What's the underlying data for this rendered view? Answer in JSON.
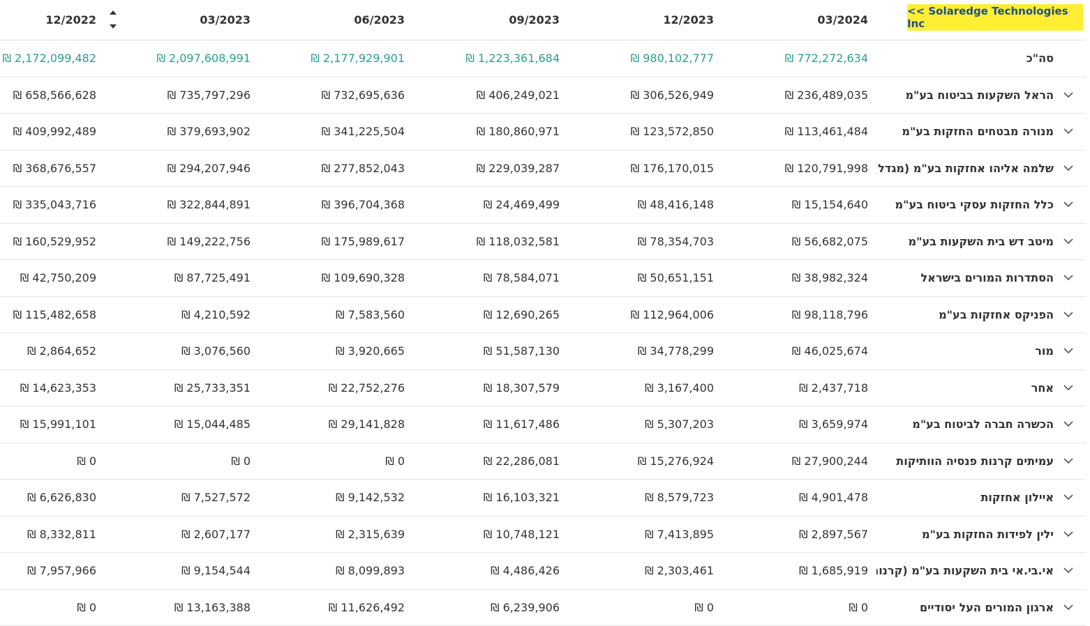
{
  "header": {
    "columns": [
      "12/2022",
      "03/2023",
      "06/2023",
      "09/2023",
      "12/2023",
      "03/2024"
    ],
    "company_link": "<< Solaredge Technologies Inc"
  },
  "total": {
    "label": "סה\"כ",
    "values": [
      "₪ 2,172,099,482",
      "₪ 2,097,608,991",
      "₪ 2,177,929,901",
      "₪ 1,223,361,684",
      "₪ 980,102,777",
      "₪ 772,272,634"
    ]
  },
  "rows": [
    {
      "name": "הראל השקעות בביטוח בע\"מ",
      "values": [
        "₪ 658,566,628",
        "₪ 735,797,296",
        "₪ 732,695,636",
        "₪ 406,249,021",
        "₪ 306,526,949",
        "₪ 236,489,035"
      ]
    },
    {
      "name": "מנורה מבטחים החזקות בע\"מ",
      "values": [
        "₪ 409,992,489",
        "₪ 379,693,902",
        "₪ 341,225,504",
        "₪ 180,860,971",
        "₪ 123,572,850",
        "₪ 113,461,484"
      ]
    },
    {
      "name": "שלמה אליהו אחזקות בע\"מ (מגדל)",
      "values": [
        "₪ 368,676,557",
        "₪ 294,207,946",
        "₪ 277,852,043",
        "₪ 229,039,287",
        "₪ 176,170,015",
        "₪ 120,791,998"
      ]
    },
    {
      "name": "כלל החזקות עסקי ביטוח בע\"מ",
      "values": [
        "₪ 335,043,716",
        "₪ 322,844,891",
        "₪ 396,704,368",
        "₪ 24,469,499",
        "₪ 48,416,148",
        "₪ 15,154,640"
      ]
    },
    {
      "name": "מיטב דש בית השקעות בע\"מ",
      "values": [
        "₪ 160,529,952",
        "₪ 149,222,756",
        "₪ 175,989,617",
        "₪ 118,032,581",
        "₪ 78,354,703",
        "₪ 56,682,075"
      ]
    },
    {
      "name": "הסתדרות המורים בישראל",
      "values": [
        "₪ 42,750,209",
        "₪ 87,725,491",
        "₪ 109,690,328",
        "₪ 78,584,071",
        "₪ 50,651,151",
        "₪ 38,982,324"
      ]
    },
    {
      "name": "הפניקס אחזקות בע\"מ",
      "values": [
        "₪ 115,482,658",
        "₪ 4,210,592",
        "₪ 7,583,560",
        "₪ 12,690,265",
        "₪ 112,964,006",
        "₪ 98,118,796"
      ]
    },
    {
      "name": "מור",
      "values": [
        "₪ 2,864,652",
        "₪ 3,076,560",
        "₪ 3,920,665",
        "₪ 51,587,130",
        "₪ 34,778,299",
        "₪ 46,025,674"
      ]
    },
    {
      "name": "אחר",
      "values": [
        "₪ 14,623,353",
        "₪ 25,733,351",
        "₪ 22,752,276",
        "₪ 18,307,579",
        "₪ 3,167,400",
        "₪ 2,437,718"
      ]
    },
    {
      "name": "הכשרה חברה לביטוח בע\"מ",
      "values": [
        "₪ 15,991,101",
        "₪ 15,044,485",
        "₪ 29,141,828",
        "₪ 11,617,486",
        "₪ 5,307,203",
        "₪ 3,659,974"
      ]
    },
    {
      "name": "עמיתים קרנות פנסיה הוותיקות",
      "values": [
        "₪ 0",
        "₪ 0",
        "₪ 0",
        "₪ 22,286,081",
        "₪ 15,276,924",
        "₪ 27,900,244"
      ]
    },
    {
      "name": "איילון אחזקות",
      "values": [
        "₪ 6,626,830",
        "₪ 7,527,572",
        "₪ 9,142,532",
        "₪ 16,103,321",
        "₪ 8,579,723",
        "₪ 4,901,478"
      ]
    },
    {
      "name": "ילין לפידות החזקות בע\"מ",
      "values": [
        "₪ 8,332,811",
        "₪ 2,607,177",
        "₪ 2,315,639",
        "₪ 10,748,121",
        "₪ 7,413,895",
        "₪ 2,897,567"
      ]
    },
    {
      "name": "אי.בי.אי בית השקעות בע\"מ (קרנות נ",
      "values": [
        "₪ 7,957,966",
        "₪ 9,154,544",
        "₪ 8,099,893",
        "₪ 4,486,426",
        "₪ 2,303,461",
        "₪ 1,685,919"
      ]
    },
    {
      "name": "ארגון המורים העל יסודיים",
      "values": [
        "₪ 0",
        "₪ 13,163,388",
        "₪ 11,626,492",
        "₪ 6,239,906",
        "₪ 0",
        "₪ 0"
      ]
    }
  ]
}
